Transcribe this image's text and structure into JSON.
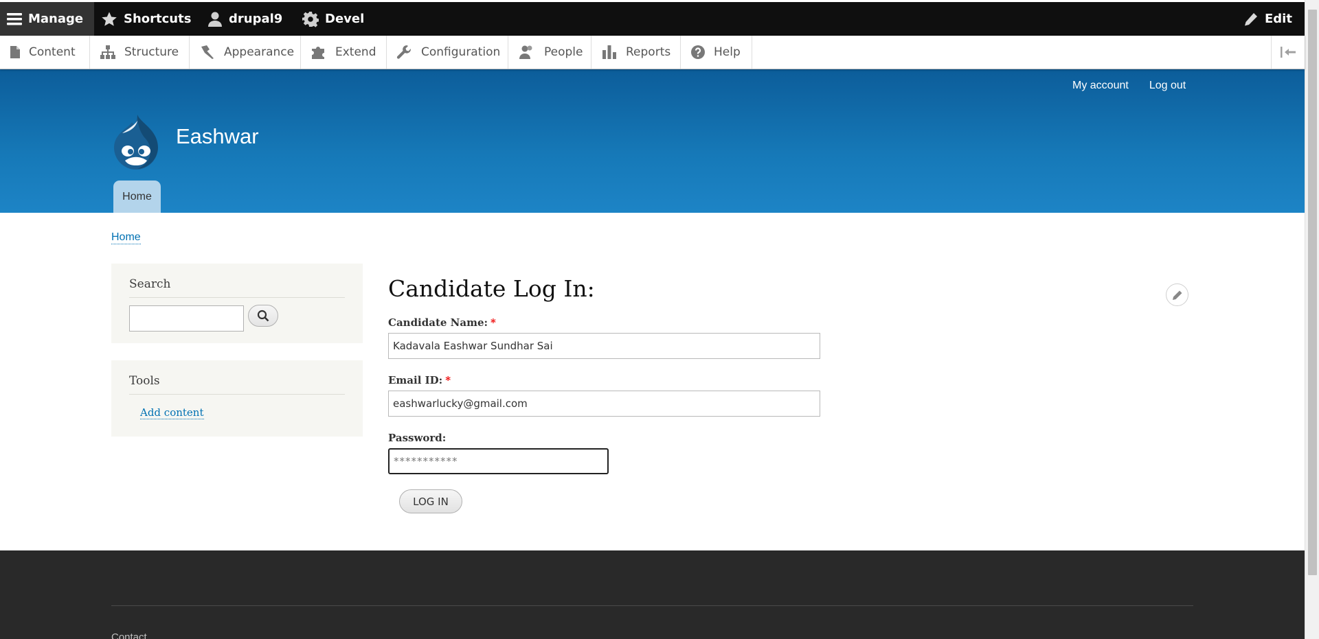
{
  "toolbar": {
    "manage": "Manage",
    "shortcuts": "Shortcuts",
    "user": "drupal9",
    "devel": "Devel",
    "edit": "Edit"
  },
  "tray": {
    "items": [
      {
        "label": "Content",
        "icon": "file-icon"
      },
      {
        "label": "Structure",
        "icon": "sitemap-icon"
      },
      {
        "label": "Appearance",
        "icon": "paintbrush-icon"
      },
      {
        "label": "Extend",
        "icon": "puzzle-icon"
      },
      {
        "label": "Configuration",
        "icon": "wrench-icon"
      },
      {
        "label": "People",
        "icon": "people-icon"
      },
      {
        "label": "Reports",
        "icon": "bar-chart-icon"
      },
      {
        "label": "Help",
        "icon": "question-icon"
      }
    ]
  },
  "header": {
    "site_name": "Eashwar",
    "secondary": [
      "My account",
      "Log out"
    ],
    "main_nav": [
      "Home"
    ]
  },
  "breadcrumb": "Home",
  "sidebar": {
    "search_title": "Search",
    "search_value": "",
    "tools_title": "Tools",
    "tools_link": "Add content"
  },
  "main": {
    "title": "Candidate Log In:",
    "fields": {
      "name_label": "Candidate Name:",
      "name_value": "Kadavala Eashwar Sundhar Sai",
      "email_label": "Email ID:",
      "email_value": "eashwarlucky@gmail.com",
      "password_label": "Password:",
      "password_value": "***********",
      "required_mark": "*"
    },
    "submit": "LOG IN"
  },
  "footer": {
    "link": "Contact"
  },
  "colors": {
    "header_top": "#0c5d9a",
    "header_bottom": "#1d84c6",
    "link": "#0071b3",
    "toolbar": "#0f0f0f",
    "footer": "#292929"
  }
}
